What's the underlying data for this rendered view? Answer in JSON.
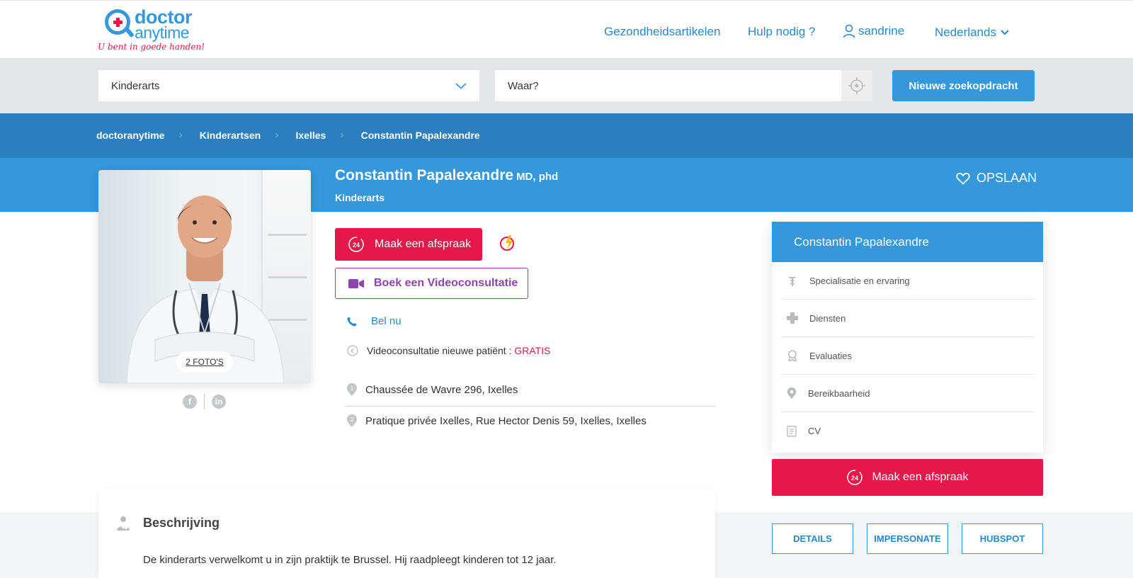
{
  "brand": {
    "logo_line1": "doctor",
    "logo_line2": "anytime",
    "tagline": "U bent in goede handen!"
  },
  "topnav": {
    "articles": "Gezondheidsartikelen",
    "help": "Hulp nodig ?",
    "user": "sandrine",
    "language": "Nederlands"
  },
  "search": {
    "specialty_value": "Kinderarts",
    "where_placeholder": "Waar?",
    "new_search_label": "Nieuwe zoekopdracht"
  },
  "breadcrumb": [
    "doctoranytime",
    "Kinderartsen",
    "Ixelles",
    "Constantin Papalexandre"
  ],
  "doctor": {
    "name": "Constantin Papalexandre",
    "title": "MD, phd",
    "specialty": "Kinderarts",
    "photos_label": "2 FOTO'S",
    "save_label": "OPSLAAN",
    "book_label": "Maak een afspraak",
    "video_label": "Boek een Videoconsultatie",
    "call_label": "Bel nu",
    "price_text": "Videoconsultatie nieuwe patiënt :",
    "price_value": "GRATIS",
    "address1": "Chaussée de Wavre 296, Ixelles",
    "address2": "Pratique privée Ixelles, Rue Hector Denis 59, Ixelles, Ixelles"
  },
  "side_panel": {
    "title": "Constantin Papalexandre",
    "items": [
      "Specialisatie en ervaring",
      "Diensten",
      "Evaluaties",
      "Bereikbaarheid",
      "CV"
    ],
    "book_label": "Maak een afspraak"
  },
  "admin": {
    "details": "DETAILS",
    "impersonate": "IMPERSONATE",
    "hubspot": "HUBSPOT"
  },
  "description": {
    "title": "Beschrijving",
    "text": "De kinderarts verwelkomt u in zijn praktijk te Brussel. Hij raadpleegt kinderen tot 12 jaar."
  },
  "colors": {
    "primary": "#3498db",
    "breadcrumb_bg": "#2b7fbf",
    "accent_red": "#e8174a",
    "video_purple": "#8e44ad"
  }
}
